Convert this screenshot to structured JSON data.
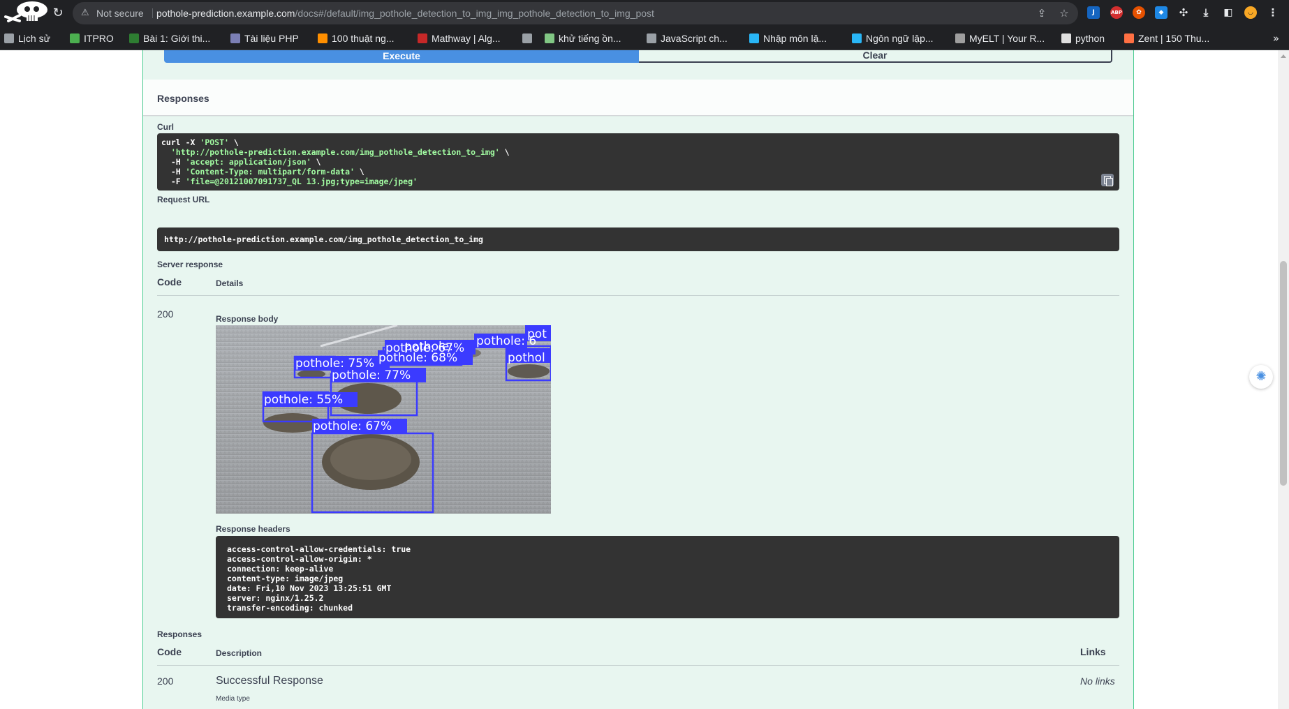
{
  "browser": {
    "not_secure": "Not secure",
    "url_host": "pothole-prediction.example.com",
    "url_path": "/docs#/default/img_pothole_detection_to_img_img_pothole_detection_to_img_post",
    "bookmarks": [
      {
        "label": "Lịch sử",
        "color": "#9aa0a6"
      },
      {
        "label": "ITPRO",
        "color": "#4caf50"
      },
      {
        "label": "Bài 1: Giới thi...",
        "color": "#2e7d32"
      },
      {
        "label": "Tài liệu PHP",
        "color": "#7b7fb5"
      },
      {
        "label": "100 thuật ng...",
        "color": "#ff8f00"
      },
      {
        "label": "Mathway | Alg...",
        "color": "#c62828"
      },
      {
        "label": "",
        "color": "#9aa0a6"
      },
      {
        "label": "khử tiếng ồn...",
        "color": "#81c784"
      },
      {
        "label": "JavaScript ch...",
        "color": "#9aa0a6"
      },
      {
        "label": "Nhập môn lậ...",
        "color": "#29b6f6"
      },
      {
        "label": "Ngôn ngữ lập...",
        "color": "#29b6f6"
      },
      {
        "label": "MyELT | Your R...",
        "color": "#9e9e9e"
      },
      {
        "label": "python",
        "color": "#e0e0e0"
      },
      {
        "label": "Zent | 150 Thu...",
        "color": "#ff7043"
      }
    ],
    "extensions": [
      {
        "name": "j-icon",
        "text": "J",
        "color": "#1565c0"
      },
      {
        "name": "adblock-icon",
        "text": "ABP",
        "color": "#d32f2f"
      },
      {
        "name": "cookie-icon",
        "text": "✿",
        "color": "#e65100"
      },
      {
        "name": "drop-icon",
        "text": "◆",
        "color": "#1e88e5"
      }
    ]
  },
  "swagger": {
    "execute_label": "Execute",
    "clear_label": "Clear",
    "responses_title": "Responses",
    "curl_label": "Curl",
    "curl_lines": [
      {
        "pre": "curl -X ",
        "str": "'POST'",
        "post": " \\"
      },
      {
        "pre": "  ",
        "str": "'http://pothole-prediction.example.com/img_pothole_detection_to_img'",
        "post": " \\"
      },
      {
        "pre": "  -H ",
        "str": "'accept: application/json'",
        "post": " \\"
      },
      {
        "pre": "  -H ",
        "str": "'Content-Type: multipart/form-data'",
        "post": " \\"
      },
      {
        "pre": "  -F ",
        "str": "'file=@20121007091737_QL 13.jpg;type=image/jpeg'",
        "post": ""
      }
    ],
    "request_url_label": "Request URL",
    "request_url": "http://pothole-prediction.example.com/img_pothole_detection_to_img",
    "server_response_label": "Server response",
    "col_code": "Code",
    "col_details": "Details",
    "status_code": "200",
    "response_body_label": "Response body",
    "detections": [
      {
        "label": "pothole: 67%"
      },
      {
        "label": "pothole: 6"
      },
      {
        "label": "pothole: 68%"
      },
      {
        "label": "pot"
      },
      {
        "label": "pothol"
      },
      {
        "label": "pothole: 75%"
      },
      {
        "label": "pothole: 77%"
      },
      {
        "label": "pothole: 55%"
      },
      {
        "label": "pothole: 67%"
      },
      {
        "label": "pothole: "
      }
    ],
    "response_headers_label": "Response headers",
    "response_headers": "access-control-allow-credentials: true\naccess-control-allow-origin: *\nconnection: keep-alive\ncontent-type: image/jpeg\ndate: Fri,10 Nov 2023 13:25:51 GMT\nserver: nginx/1.25.2\ntransfer-encoding: chunked",
    "responses_label": "Responses",
    "col_description": "Description",
    "col_links": "Links",
    "resp_code": "200",
    "resp_description": "Successful Response",
    "resp_links": "No links",
    "media_type_label": "Media type"
  }
}
